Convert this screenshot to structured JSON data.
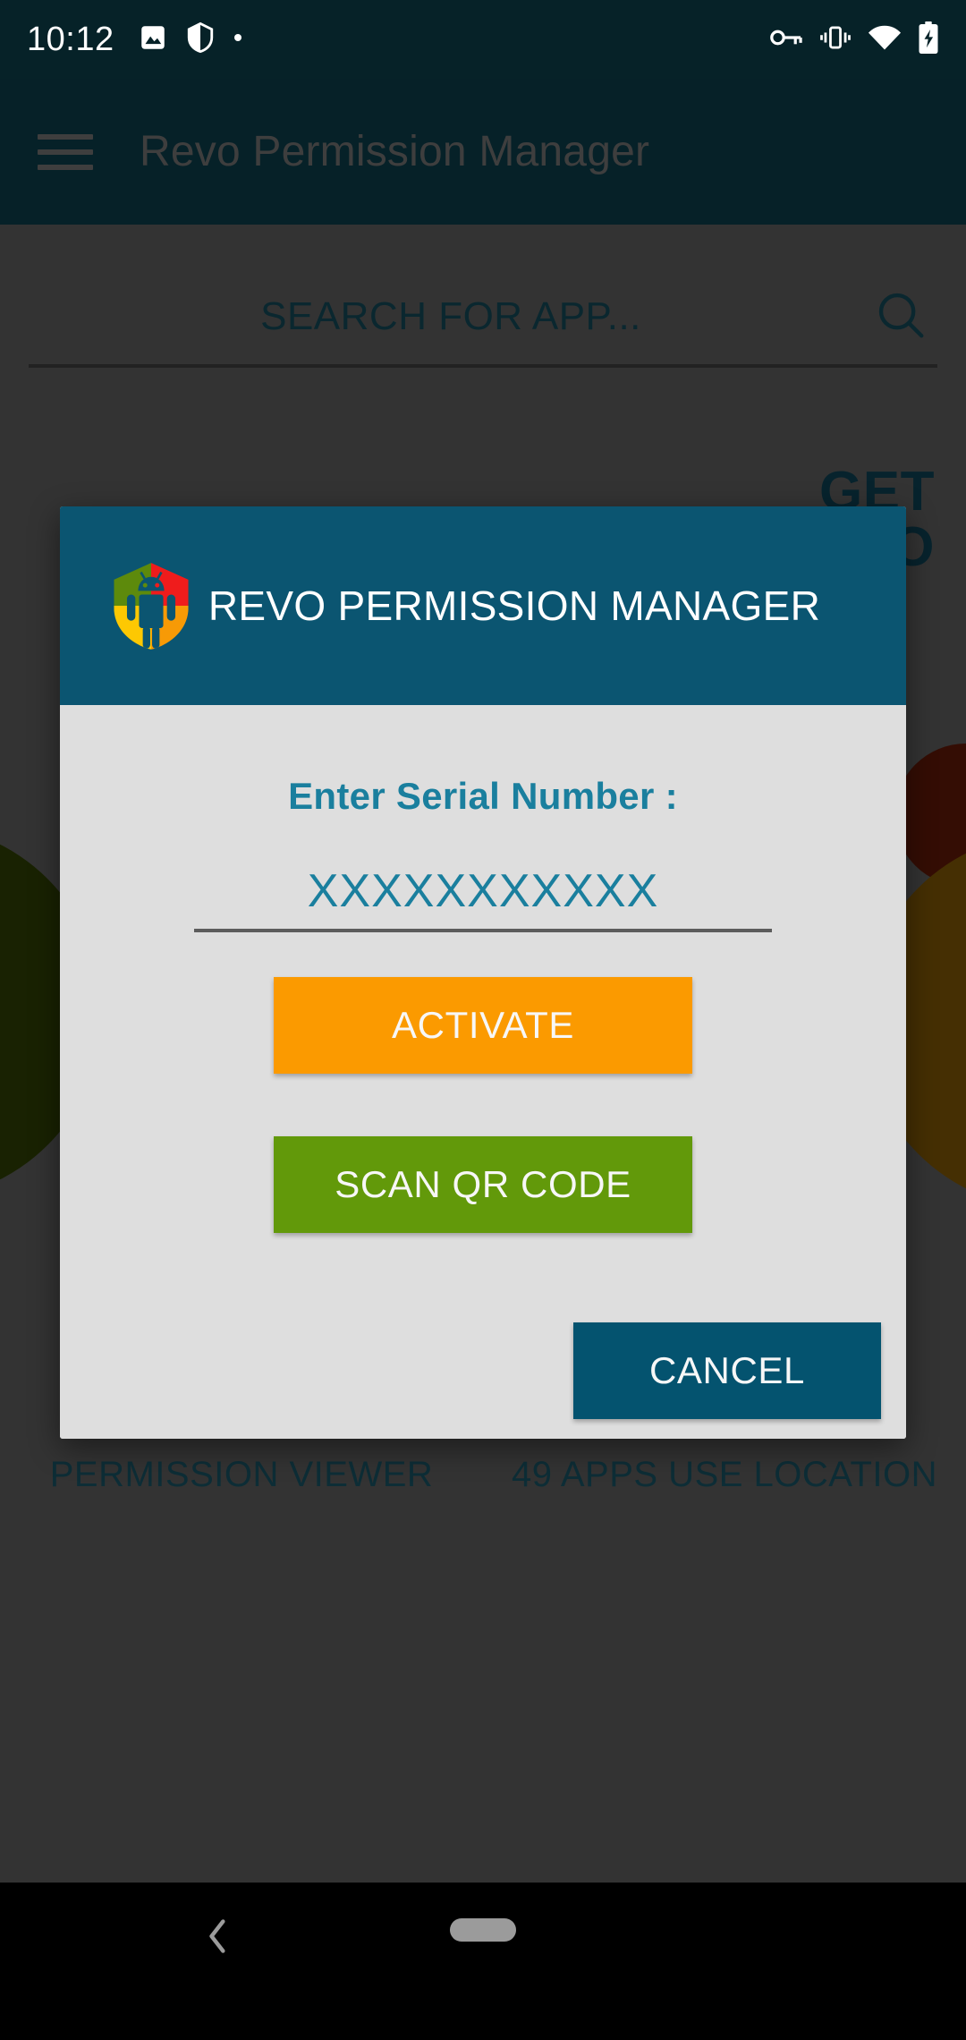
{
  "status_bar": {
    "clock": "10:12",
    "left_icons": [
      "image-icon",
      "shield-icon",
      "dot-icon"
    ],
    "right_icons": [
      "vpn-key-icon",
      "vibrate-icon",
      "wifi-icon",
      "battery-charging-icon"
    ]
  },
  "app_bar": {
    "menu_icon": "hamburger-menu-icon",
    "title": "Revo Permission Manager"
  },
  "search": {
    "placeholder": "SEARCH FOR APP...",
    "icon": "search-icon"
  },
  "get_pro": {
    "line1": "GET",
    "line2": "PRO"
  },
  "features": [
    {
      "icon": "shield-eye-icon",
      "label": "PERMISSION VIEWER"
    },
    {
      "icon": "shield-location-icon",
      "label": "49 APPS USE LOCATION"
    }
  ],
  "dialog": {
    "logo": "revo-shield-android-logo",
    "title": "REVO PERMISSION MANAGER",
    "serial_label": "Enter Serial Number :",
    "serial_value": "XXXXXXXXXXX",
    "serial_placeholder": "XXXXXXXXXXX",
    "activate_label": "ACTIVATE",
    "scan_qr_label": "SCAN QR CODE",
    "cancel_label": "CANCEL"
  },
  "nav_bar": {
    "back_icon": "back-chevron-icon",
    "home_icon": "home-pill-icon"
  },
  "colors": {
    "status_bar": "#062228",
    "app_bar": "#0b3a47",
    "dialog_header": "#0b5571",
    "dialog_body": "#dedede",
    "teal_text": "#1a7f9e",
    "activate_orange": "#fb9a00",
    "scan_green": "#62990a",
    "cancel_teal": "#04536f",
    "page_dim": "#5a5a5a",
    "feature_text": "#17505f"
  }
}
